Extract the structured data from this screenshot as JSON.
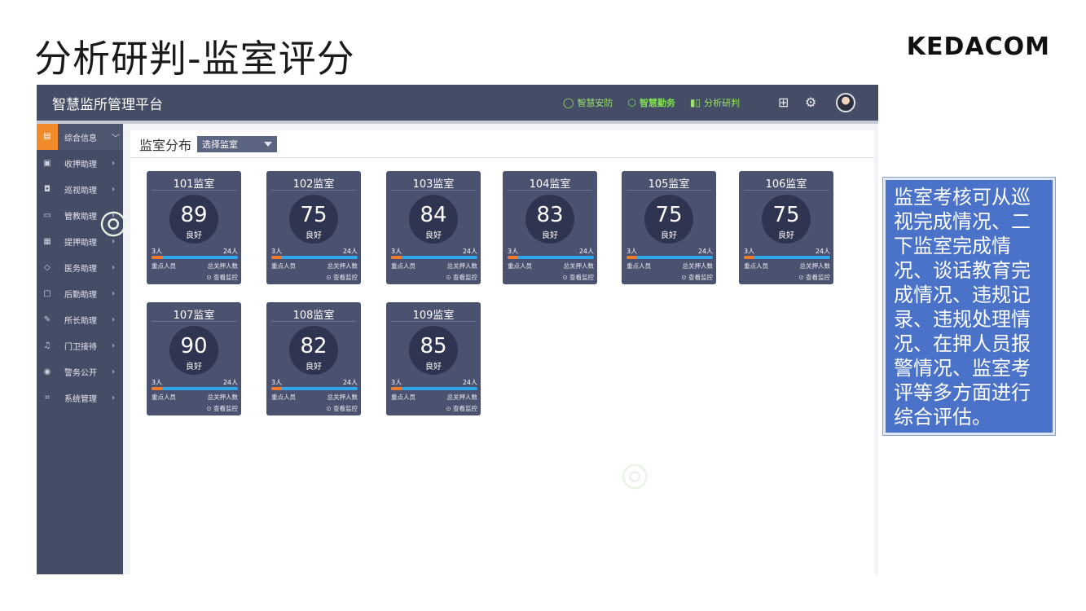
{
  "slide": {
    "title": "分析研判-监室评分",
    "brand": "KEDACOM"
  },
  "app": {
    "title": "智慧监所管理平台",
    "topnav": [
      {
        "label": "智慧安防",
        "icon": "circle-icon"
      },
      {
        "label": "智慧勤务",
        "icon": "cube-icon"
      },
      {
        "label": "分析研判",
        "icon": "bar-chart-icon"
      }
    ],
    "top_icons": [
      "grid-icon",
      "gear-icon",
      "avatar"
    ]
  },
  "sidebar": {
    "items": [
      {
        "label": "综合信息",
        "icon": "document-icon",
        "chevron": "﹀",
        "active": true
      },
      {
        "label": "收押助理",
        "icon": "building-icon",
        "chevron": "›"
      },
      {
        "label": "巡视助理",
        "icon": "camera-icon",
        "chevron": "›"
      },
      {
        "label": "管教助理",
        "icon": "book-icon",
        "chevron": "›"
      },
      {
        "label": "提押助理",
        "icon": "clipboard-icon",
        "chevron": "›"
      },
      {
        "label": "医务助理",
        "icon": "medical-icon",
        "chevron": "›"
      },
      {
        "label": "后勤助理",
        "icon": "box-icon",
        "chevron": "›"
      },
      {
        "label": "所长助理",
        "icon": "pen-icon",
        "chevron": "›"
      },
      {
        "label": "门卫接待",
        "icon": "bell-icon",
        "chevron": "›"
      },
      {
        "label": "警务公开",
        "icon": "location-icon",
        "chevron": "›"
      },
      {
        "label": "系统管理",
        "icon": "settings-icon",
        "chevron": "›"
      }
    ]
  },
  "filter": {
    "label": "监室分布",
    "select_value": "选择监室"
  },
  "rooms": [
    {
      "name": "101监室",
      "score": "89",
      "grade": "良好",
      "key_count": "3人",
      "total_count": "24人",
      "key_label": "重点人员",
      "total_label": "总关押人数",
      "monitor": "⊙ 查看监控",
      "key_ratio": 0.125
    },
    {
      "name": "102监室",
      "score": "75",
      "grade": "良好",
      "key_count": "3人",
      "total_count": "24人",
      "key_label": "重点人员",
      "total_label": "总关押人数",
      "monitor": "⊙ 查看监控",
      "key_ratio": 0.125
    },
    {
      "name": "103监室",
      "score": "84",
      "grade": "良好",
      "key_count": "3人",
      "total_count": "24人",
      "key_label": "重点人员",
      "total_label": "总关押人数",
      "monitor": "⊙ 查看监控",
      "key_ratio": 0.125
    },
    {
      "name": "104监室",
      "score": "83",
      "grade": "良好",
      "key_count": "3人",
      "total_count": "24人",
      "key_label": "重点人员",
      "total_label": "总关押人数",
      "monitor": "⊙ 查看监控",
      "key_ratio": 0.125
    },
    {
      "name": "105监室",
      "score": "75",
      "grade": "良好",
      "key_count": "3人",
      "total_count": "24人",
      "key_label": "重点人员",
      "total_label": "总关押人数",
      "monitor": "⊙ 查看监控",
      "key_ratio": 0.125
    },
    {
      "name": "106监室",
      "score": "75",
      "grade": "良好",
      "key_count": "3人",
      "total_count": "24人",
      "key_label": "重点人员",
      "total_label": "总关押人数",
      "monitor": "⊙ 查看监控",
      "key_ratio": 0.125
    },
    {
      "name": "107监室",
      "score": "90",
      "grade": "良好",
      "key_count": "3人",
      "total_count": "24人",
      "key_label": "重点人员",
      "total_label": "总关押人数",
      "monitor": "⊙ 查看监控",
      "key_ratio": 0.125
    },
    {
      "name": "108监室",
      "score": "82",
      "grade": "良好",
      "key_count": "3人",
      "total_count": "24人",
      "key_label": "重点人员",
      "total_label": "总关押人数",
      "monitor": "⊙ 查看监控",
      "key_ratio": 0.125
    },
    {
      "name": "109监室",
      "score": "85",
      "grade": "良好",
      "key_count": "3人",
      "total_count": "24人",
      "key_label": "重点人员",
      "total_label": "总关押人数",
      "monitor": "⊙ 查看监控",
      "key_ratio": 0.125
    }
  ],
  "info": {
    "text": "监室考核可从巡视完成情况、二下监室完成情况、谈话教育完成情况、违规记录、违规处理情况、在押人员报警情况、监室考评等多方面进行综合评估。"
  },
  "colors": {
    "navbar": "#454d66",
    "card": "#4a5270",
    "accent_green": "#7ee04a",
    "bar_blue": "#2fa6e8",
    "bar_orange": "#f07a2c",
    "info_box": "#4a72c8"
  }
}
